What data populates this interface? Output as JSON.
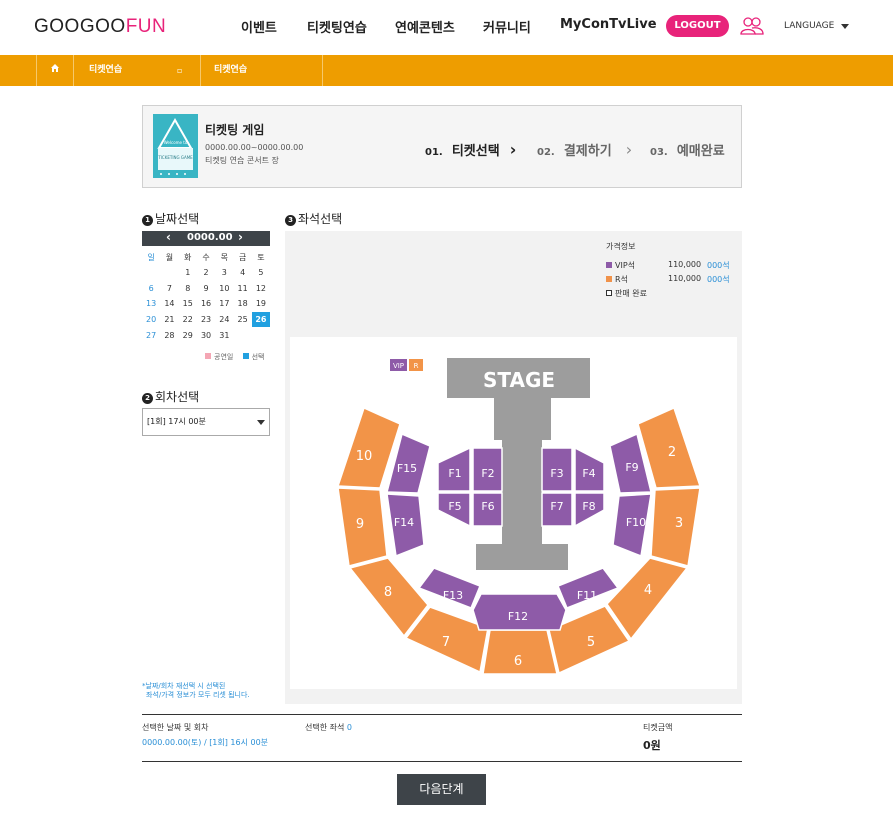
{
  "header": {
    "logo_part1": "GOOGOO",
    "logo_part2": "FUN",
    "nav": [
      "이벤트",
      "티켓팅연습",
      "연예콘텐츠",
      "커뮤니티",
      "MyConTvLive"
    ],
    "logout": "LOGOUT",
    "language": "LANGUAGE"
  },
  "breadcrumb": {
    "item1": "티켓연습",
    "separator": "▫",
    "item2": "티켓연습"
  },
  "event": {
    "title": "티켓팅 게임",
    "dates": "0000.00.00~0000.00.00",
    "venue": "티켓팅 연습 콘서트 장",
    "poster_text_top": "Welcome to",
    "poster_text_bottom": "TICKETING GAME"
  },
  "steps": [
    {
      "num": "01.",
      "label": "티켓선택"
    },
    {
      "num": "02.",
      "label": "결제하기"
    },
    {
      "num": "03.",
      "label": "예매완료"
    }
  ],
  "step_arrow": "›",
  "date_section": {
    "num": "1",
    "title": "날짜선택",
    "month": "0000.00",
    "prev": "‹",
    "next": "›",
    "weekdays": [
      "일",
      "월",
      "화",
      "수",
      "목",
      "금",
      "토"
    ],
    "weeks": [
      [
        "",
        "",
        "1",
        "2",
        "3",
        "4",
        "5"
      ],
      [
        "6",
        "7",
        "8",
        "9",
        "10",
        "11",
        "12"
      ],
      [
        "13",
        "14",
        "15",
        "16",
        "17",
        "18",
        "19"
      ],
      [
        "20",
        "21",
        "22",
        "23",
        "24",
        "25",
        "26"
      ],
      [
        "27",
        "28",
        "29",
        "30",
        "31",
        "",
        ""
      ]
    ],
    "selected_day": "26",
    "legend_holiday": "공연일",
    "legend_selected": "선택",
    "holiday_color": "#f4a6b4",
    "selected_color": "#21a0e0"
  },
  "session_section": {
    "num": "2",
    "title": "회차선택",
    "selected": "[1회] 17시 00분"
  },
  "seat_section": {
    "num": "3",
    "title": "좌석선택"
  },
  "price_info": {
    "title": "가격정보",
    "rows": [
      {
        "name": "VIP석",
        "price": "110,000",
        "remain": "000석",
        "color": "#8e5ba8"
      },
      {
        "name": "R석",
        "price": "110,000",
        "remain": "000석",
        "color": "#f0924a"
      },
      {
        "name": "판매 완료",
        "price": "",
        "remain": "",
        "color": "#ffffff"
      }
    ]
  },
  "map": {
    "stage": "STAGE",
    "tag_vip": "VIP",
    "tag_r": "R",
    "vip_color": "#8e5ba8",
    "r_color": "#f29448",
    "floor_labels": [
      "F1",
      "F2",
      "F3",
      "F4",
      "F5",
      "F6",
      "F7",
      "F8",
      "F9",
      "F10",
      "F11",
      "F12",
      "F13",
      "F14",
      "F15"
    ],
    "section_labels": [
      "2",
      "3",
      "4",
      "5",
      "6",
      "7",
      "8",
      "9",
      "10"
    ]
  },
  "note": {
    "line1": "*날짜/회차 재선택 시 선택된",
    "line2": "좌석/가격 정보가 모두 리셋 됩니다."
  },
  "summary": {
    "selected_date_label": "선택한 날짜 및 회차",
    "selected_date_value": "0000.00.00(토) / [1회] 16시 00분",
    "selected_seat_label": "선택한 좌석",
    "selected_seat_count": "0",
    "price_label": "티켓금액",
    "price_value": "0원"
  },
  "next_button": "다음단계"
}
